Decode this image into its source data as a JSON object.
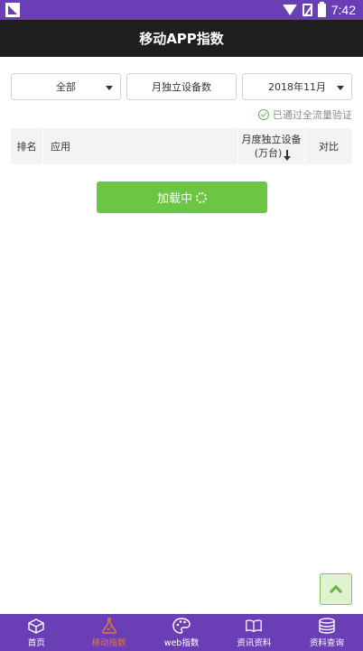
{
  "status_bar": {
    "time": "7:42"
  },
  "title": "移动APP指数",
  "filters": {
    "category": "全部",
    "metric": "月独立设备数",
    "month": "2018年11月"
  },
  "verify_text": "已通过全流量验证",
  "table": {
    "col_rank": "排名",
    "col_app": "应用",
    "col_devices_line1": "月度独立设备",
    "col_devices_line2": "(万台)",
    "col_compare": "对比"
  },
  "loading_label": "加载中",
  "tabs": [
    {
      "label": "首页",
      "icon": "box-icon",
      "active": false
    },
    {
      "label": "移动指数",
      "icon": "flask-icon",
      "active": true
    },
    {
      "label": "web指数",
      "icon": "palette-icon",
      "active": false
    },
    {
      "label": "资讯资料",
      "icon": "book-icon",
      "active": false
    },
    {
      "label": "资料查询",
      "icon": "database-icon",
      "active": false
    }
  ],
  "colors": {
    "accent": "#6a3fb5",
    "active_tab": "#e8763c",
    "green": "#6cc644"
  }
}
